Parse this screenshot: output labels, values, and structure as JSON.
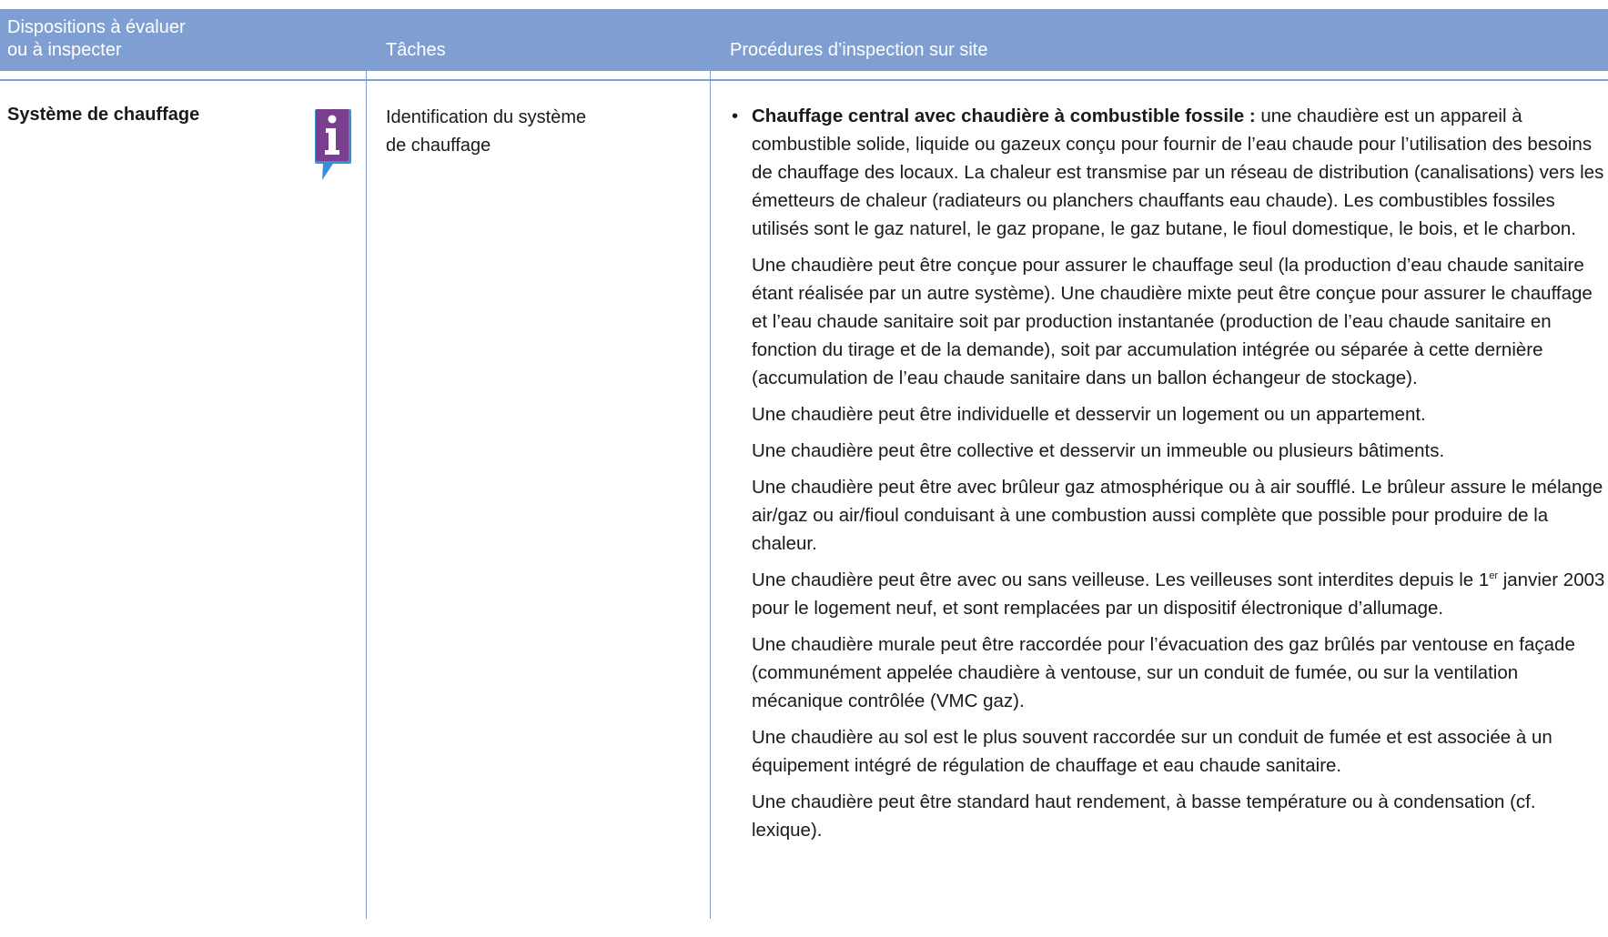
{
  "header": {
    "col1": "Dispositions à évaluer ou à inspecter",
    "col1_line1": "Dispositions à évaluer",
    "col1_line2": "ou à inspecter",
    "col2": "Tâches",
    "col3": "Procédures d’inspection sur site"
  },
  "row": {
    "provision": "Système de chauffage",
    "info_icon": "info-icon",
    "task_line1": "Identification du système",
    "task_line2": "de chauffage",
    "bullet_title": "Chauffage central avec chaudière à combustible fossile :",
    "bullet_text": " une chaudière est un appareil à combustible solide, liquide ou gazeux conçu pour fournir de l’eau chaude pour l’utilisation des besoins de chauffage des locaux. La chaleur est transmise par un réseau de distribution (canalisations) vers les émetteurs de chaleur (radiateurs ou planchers chauffants eau chaude). Les combustibles fossiles utilisés sont le gaz naturel, le gaz propane, le gaz butane, le fioul domestique, le bois, et le charbon.",
    "para2": "Une chaudière peut être conçue pour assurer le chauffage seul (la production d’eau chaude sanitaire étant réalisée par un autre système). Une chaudière mixte peut être conçue pour assurer le chauffage et l’eau chaude sanitaire soit par production instantanée (production de l’eau chaude sanitaire en fonction du tirage et de la demande), soit par accumulation intégrée ou séparée à cette dernière (accumulation de l’eau chaude sanitaire dans un ballon échangeur de stockage).",
    "para3": "Une chaudière peut être individuelle et desservir un logement ou un appartement.",
    "para4": "Une chaudière peut être collective et desservir un immeuble ou plusieurs bâtiments.",
    "para5": "Une chaudière peut être avec brûleur gaz atmosphérique ou à air soufflé. Le brûleur assure le mélange air/gaz ou air/fioul conduisant à une combustion aussi complète que possible pour produire de la chaleur.",
    "para6_a": "Une chaudière peut être avec ou sans veilleuse. Les veilleuses sont interdites depuis le 1",
    "para6_sup": "er",
    "para6_b": " janvier 2003 pour le logement neuf, et sont remplacées par un dispositif électronique d’allumage.",
    "para7": "Une chaudière murale peut être raccordée pour l’évacuation des gaz brûlés par ventouse en façade (communément appelée chaudière à ventouse, sur un conduit de fumée, ou sur la ventilation mécanique contrôlée (VMC gaz).",
    "para8": "Une chaudière au sol est le plus souvent raccordée sur un conduit de fumée et est associée à un équipement intégré de régulation de chauffage et eau chaude sanitaire.",
    "para9": "Une chaudière peut être standard haut rendement, à basse température ou à condensation (cf. lexique)."
  },
  "colors": {
    "header_bg": "#7f9fd2",
    "icon_purple": "#7b3f8f",
    "icon_blue": "#3c8fd6"
  }
}
